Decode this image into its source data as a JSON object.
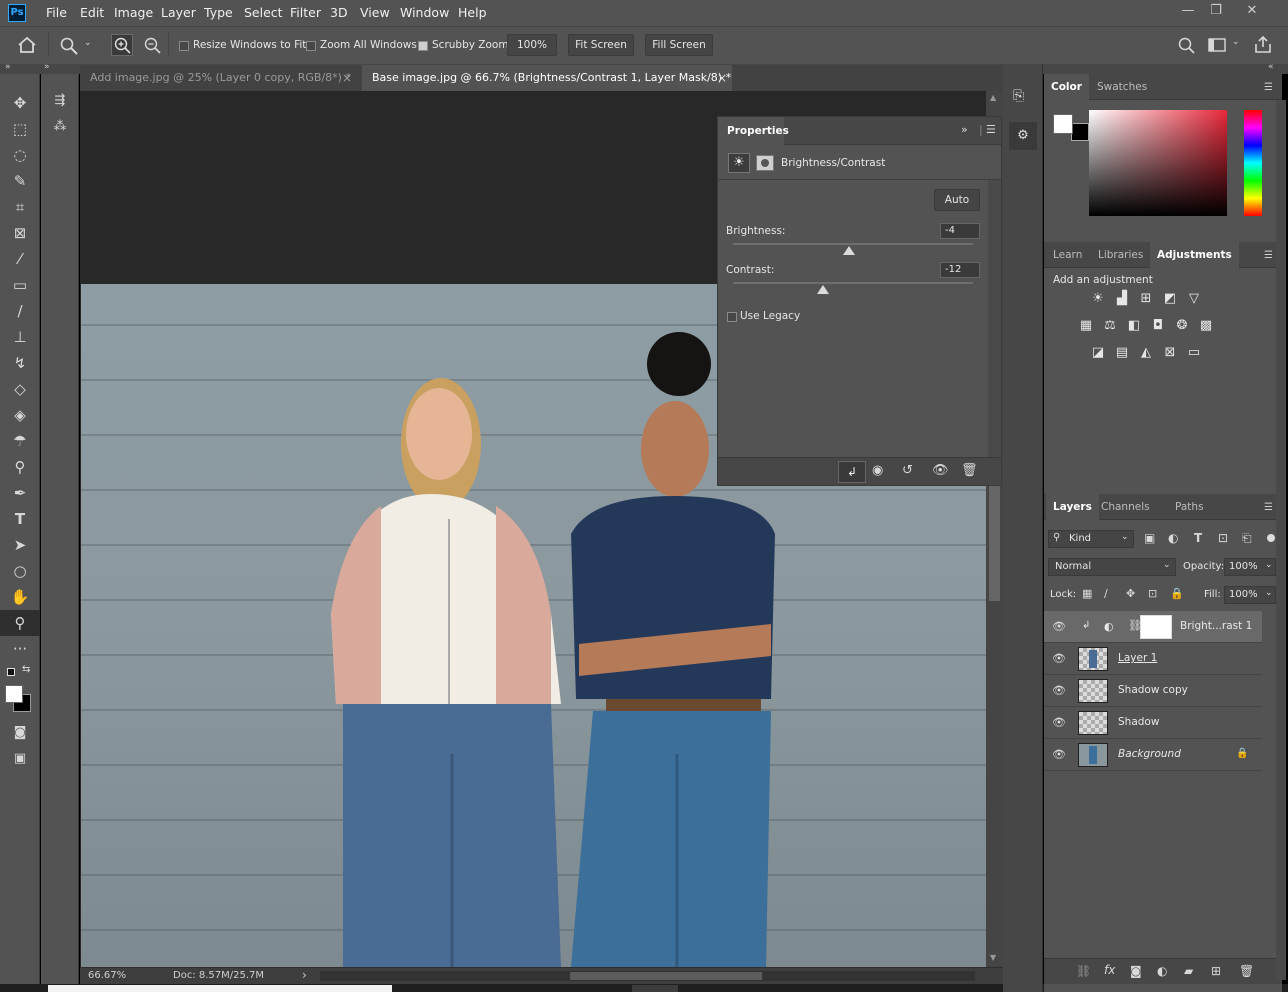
{
  "app": {
    "logo": "Ps"
  },
  "menu": [
    "File",
    "Edit",
    "Image",
    "Layer",
    "Type",
    "Select",
    "Filter",
    "3D",
    "View",
    "Window",
    "Help"
  ],
  "window_controls": {
    "minimize": "—",
    "restore": "❐",
    "close": "✕"
  },
  "options_bar": {
    "resize_windows_label": "Resize Windows to Fit",
    "resize_windows_checked": false,
    "zoom_all_label": "Zoom All Windows",
    "zoom_all_checked": false,
    "scrubby_zoom_label": "Scrubby Zoom",
    "scrubby_zoom_checked": true,
    "zoom_value": "100%",
    "fit_screen_label": "Fit Screen",
    "fill_screen_label": "Fill Screen"
  },
  "tabs": [
    {
      "title": "Add image.jpg @ 25% (Layer 0 copy, RGB/8*) *",
      "active": false
    },
    {
      "title": "Base image.jpg @ 66.7% (Brightness/Contrast 1, Layer Mask/8) *",
      "active": true
    }
  ],
  "tab_close_glyph": "×",
  "status": {
    "zoom": "66.67%",
    "doc": "Doc: 8.57M/25.7M",
    "arrow": "›"
  },
  "properties": {
    "title": "Properties",
    "adjustment": "Brightness/Contrast",
    "auto_label": "Auto",
    "brightness_label": "Brightness:",
    "brightness_value": "-4",
    "contrast_label": "Contrast:",
    "contrast_value": "-12",
    "use_legacy_label": "Use Legacy",
    "use_legacy_checked": false
  },
  "color_panel": {
    "tabs": [
      "Color",
      "Swatches"
    ],
    "active_tab": "Color",
    "foreground": "#ffffff",
    "background": "#000000",
    "hue_color": "#e8283a"
  },
  "adjustments_panel": {
    "tabs": [
      "Learn",
      "Libraries",
      "Adjustments"
    ],
    "active_tab": "Adjustments",
    "hint": "Add an adjustment",
    "row1": [
      "brightness-icon",
      "levels-icon",
      "curves-icon",
      "exposure-icon",
      "vibrance-icon"
    ],
    "row2": [
      "hsl-icon",
      "color-balance-icon",
      "black-white-icon",
      "photo-filter-icon",
      "channel-mixer-icon",
      "color-lookup-icon"
    ],
    "row3": [
      "invert-icon",
      "posterize-icon",
      "threshold-icon",
      "selective-color-icon",
      "gradient-map-icon"
    ]
  },
  "layers_panel": {
    "tabs": [
      "Layers",
      "Channels",
      "Paths"
    ],
    "active_tab": "Layers",
    "filter_kind": "Kind",
    "blend_mode": "Normal",
    "opacity_label": "Opacity:",
    "opacity_value": "100%",
    "lock_label": "Lock:",
    "fill_label": "Fill:",
    "fill_value": "100%",
    "layers": [
      {
        "name": "Bright...rast 1",
        "selected": true,
        "type": "adjustment"
      },
      {
        "name": "Layer 1",
        "selected": false,
        "type": "image"
      },
      {
        "name": "Shadow copy",
        "selected": false,
        "type": "transparent"
      },
      {
        "name": "Shadow",
        "selected": false,
        "type": "transparent"
      },
      {
        "name": "Background",
        "selected": false,
        "type": "image",
        "locked": true
      }
    ],
    "footer_icons": [
      "link-icon",
      "fx-icon",
      "mask-icon",
      "adjustment-icon",
      "folder-icon",
      "new-layer-icon",
      "trash-icon"
    ]
  }
}
